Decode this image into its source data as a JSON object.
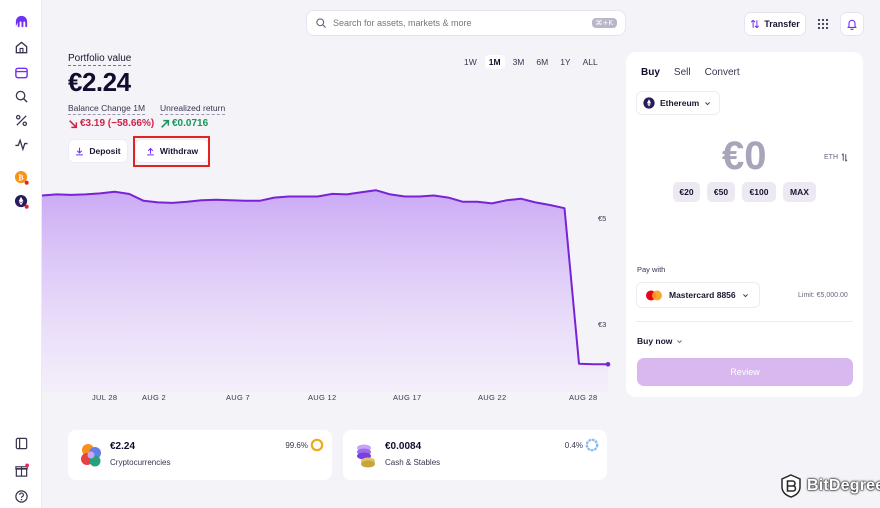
{
  "search": {
    "placeholder": "Search for assets, markets & more",
    "shortcut": "⌘+K"
  },
  "header": {
    "transfer_label": "Transfer"
  },
  "portfolio": {
    "label": "Portfolio value",
    "value": "€2.24",
    "balance_change_label": "Balance Change 1M",
    "balance_change_value": "€3.19 (−58.66%)",
    "unrealized_label": "Unrealized return",
    "unrealized_value": "€0.0716",
    "deposit_label": "Deposit",
    "withdraw_label": "Withdraw"
  },
  "periods": {
    "items": [
      "1W",
      "1M",
      "3M",
      "6M",
      "1Y",
      "ALL"
    ],
    "active": "1M"
  },
  "chart_data": {
    "type": "area",
    "x": [
      "Jul 23",
      "Jul 24",
      "Jul 25",
      "Jul 26",
      "Jul 27",
      "Jul 28",
      "Jul 29",
      "Jul 30",
      "Jul 31",
      "Aug 1",
      "Aug 2",
      "Aug 3",
      "Aug 4",
      "Aug 5",
      "Aug 6",
      "Aug 7",
      "Aug 8",
      "Aug 9",
      "Aug 10",
      "Aug 11",
      "Aug 12",
      "Aug 13",
      "Aug 14",
      "Aug 15",
      "Aug 16",
      "Aug 17",
      "Aug 18",
      "Aug 19",
      "Aug 20",
      "Aug 21",
      "Aug 22",
      "Aug 23",
      "Aug 24",
      "Aug 25",
      "Aug 26",
      "Aug 27",
      "Aug 28",
      "Aug 29"
    ],
    "values": [
      5.42,
      5.44,
      5.43,
      5.44,
      5.46,
      5.49,
      5.45,
      5.32,
      5.29,
      5.28,
      5.3,
      5.33,
      5.34,
      5.33,
      5.32,
      5.32,
      5.38,
      5.4,
      5.4,
      5.4,
      5.45,
      5.44,
      5.48,
      5.52,
      5.44,
      5.4,
      5.4,
      5.42,
      5.38,
      5.3,
      5.3,
      5.27,
      5.33,
      5.36,
      5.29,
      5.24,
      5.18,
      2.25,
      2.24,
      2.24
    ],
    "x_tick_labels": [
      "JUL 28",
      "AUG 2",
      "AUG 7",
      "AUG 12",
      "AUG 17",
      "AUG 22",
      "AUG 28"
    ],
    "y_tick_labels": [
      "€5",
      "€3"
    ],
    "y_ticks": [
      5,
      3
    ],
    "ylim": [
      2.0,
      5.9
    ],
    "grid": false,
    "color": "#7a22d6"
  },
  "holdings": [
    {
      "value": "€2.24",
      "label": "Cryptocurrencies",
      "percent": "99.6%",
      "ring_color": "#f0a81c"
    },
    {
      "value": "€0.0084",
      "label": "Cash & Stables",
      "percent": "0.4%",
      "ring_color": "#7fb8f0"
    }
  ],
  "trade": {
    "tabs": [
      "Buy",
      "Sell",
      "Convert"
    ],
    "active_tab": "Buy",
    "asset": "Ethereum",
    "amount": "€0",
    "unit": "ETH",
    "quick_amounts": [
      "€20",
      "€50",
      "€100",
      "MAX"
    ],
    "pay_with_label": "Pay with",
    "payment_method": "Mastercard 8856",
    "limit": "Limit: €5,000.00",
    "order_type": "Buy now",
    "review_label": "Review"
  },
  "watermark": {
    "text": "BitDegree"
  },
  "colors": {
    "accent": "#7a22d6",
    "negative": "#d0214a",
    "positive": "#17935b"
  }
}
